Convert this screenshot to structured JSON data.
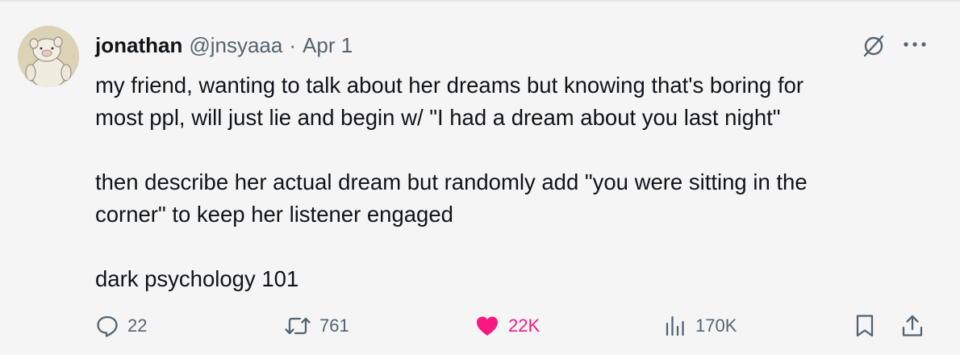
{
  "tweet": {
    "author_name": "jonathan",
    "author_handle": "@jnsyaaa",
    "separator": "·",
    "date": "Apr 1",
    "text": "my friend, wanting to talk about her dreams but knowing that's boring for\nmost ppl, will just lie and begin w/ \"I had a dream about you last night\"\n\nthen describe her actual dream but randomly add \"you were sitting in the\ncorner\" to keep her listener engaged\n\ndark psychology 101"
  },
  "actions": {
    "replies": "22",
    "reposts": "761",
    "likes": "22K",
    "views": "170K"
  },
  "colors": {
    "like_active": "#f91880",
    "secondary_text": "#536471",
    "primary_text": "#0f1419"
  },
  "icons": {
    "avatar": "pig-figure-avatar",
    "grok": "grok-icon",
    "more": "more-icon",
    "reply": "reply-icon",
    "repost": "repost-icon",
    "like": "heart-icon",
    "views": "views-chart-icon",
    "bookmark": "bookmark-icon",
    "share": "share-icon"
  }
}
